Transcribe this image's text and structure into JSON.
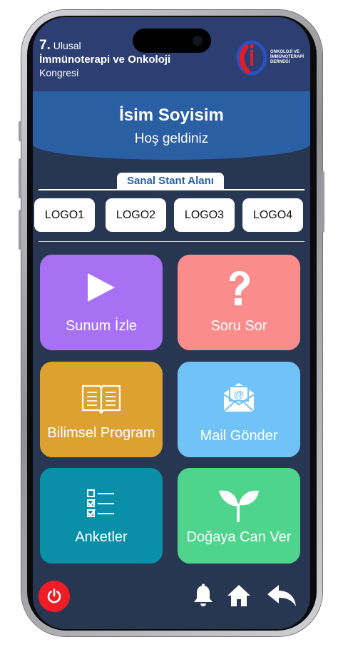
{
  "header": {
    "congress_number": "7.",
    "congress_line1": "Ulusal",
    "congress_line2": "İmmünoterapi ve Onkoloji",
    "congress_line3": "Kongresi",
    "org_line1": "ONKOLOJİ VE",
    "org_line2": "İMMÜNOTERAPİ",
    "org_line3": "DERNEĞİ"
  },
  "welcome": {
    "name": "İsim Soyisim",
    "greeting": "Hoş geldiniz"
  },
  "stand": {
    "title": "Sanal Stant Alanı",
    "logos": [
      "LOGO1",
      "LOGO2",
      "LOGO3",
      "LOGO4"
    ]
  },
  "tiles": [
    {
      "label": "Sunum İzle",
      "icon": "play-icon",
      "color": "#a870f3"
    },
    {
      "label": "Soru Sor",
      "icon": "question-icon",
      "color": "#fa8c8c"
    },
    {
      "label": "Bilimsel Program",
      "icon": "book-icon",
      "color": "#dca130"
    },
    {
      "label": "Mail Gönder",
      "icon": "mail-icon",
      "color": "#71c2f7"
    },
    {
      "label": "Anketler",
      "icon": "checklist-icon",
      "color": "#098fa8"
    },
    {
      "label": "Doğaya Can Ver",
      "icon": "sprout-icon",
      "color": "#4fd48d"
    }
  ],
  "bottom_nav": [
    "power-icon",
    "bell-icon",
    "home-icon",
    "back-icon"
  ],
  "colors": {
    "screen_bg": "#273651",
    "header_bg": "#2d3f72",
    "welcome_bg": "#2a5fa4",
    "power_red": "#ee1c25"
  }
}
